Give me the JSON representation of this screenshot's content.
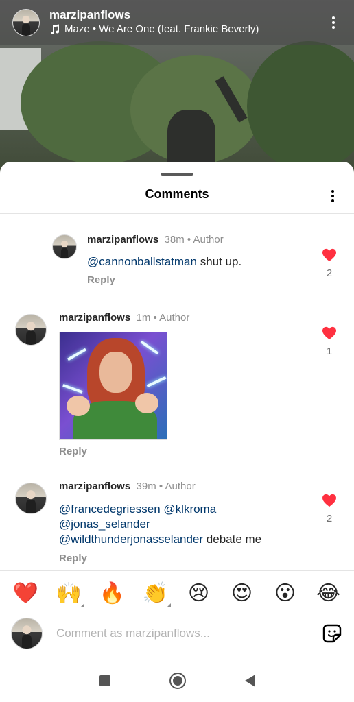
{
  "story": {
    "username": "marzipanflows",
    "song": "Maze • We Are One (feat. Frankie Beverly)"
  },
  "sheet": {
    "title": "Comments"
  },
  "comments": [
    {
      "username": "marzipanflows",
      "time": "38m",
      "separator": "•",
      "badge": "Author",
      "mentions": [
        "@cannonballstatman"
      ],
      "text": " shut up.",
      "reply_label": "Reply",
      "likes": "2"
    },
    {
      "username": "marzipanflows",
      "time": "1m",
      "separator": "•",
      "badge": "Author",
      "reply_label": "Reply",
      "likes": "1"
    },
    {
      "username": "marzipanflows",
      "time": "39m",
      "separator": "•",
      "badge": "Author",
      "mentions": [
        "@francedegriessen",
        "@klkroma",
        "@jonas_selander",
        "@wildthunderjonasselander"
      ],
      "text": " debate me",
      "reply_label": "Reply",
      "likes": "2"
    }
  ],
  "reactions": [
    "❤️",
    "🙌",
    "🔥",
    "👏",
    "😢",
    "😍",
    "😮",
    "😂"
  ],
  "composer": {
    "placeholder": "Comment as marzipanflows..."
  },
  "colors": {
    "like": "#ff3040",
    "mention": "#00376b",
    "muted": "#8e8e8e"
  }
}
